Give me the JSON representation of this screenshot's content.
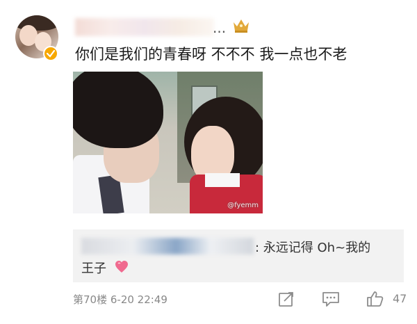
{
  "comment": {
    "username_suffix": "...",
    "text": "你们是我们的青春呀 不不不 我一点也不老"
  },
  "photo": {
    "watermark": "@fyemm"
  },
  "reply": {
    "text_line1": ": 永远记得 Oh~我的",
    "text_line2": "王子"
  },
  "footer": {
    "floor": "第70楼",
    "timestamp": "6-20 22:49",
    "like_count": "47"
  },
  "colors": {
    "badge": "#f7a800",
    "crown": "#e2a93a",
    "heart": "#f06a8f",
    "icon_gray": "#8c8c8c"
  }
}
